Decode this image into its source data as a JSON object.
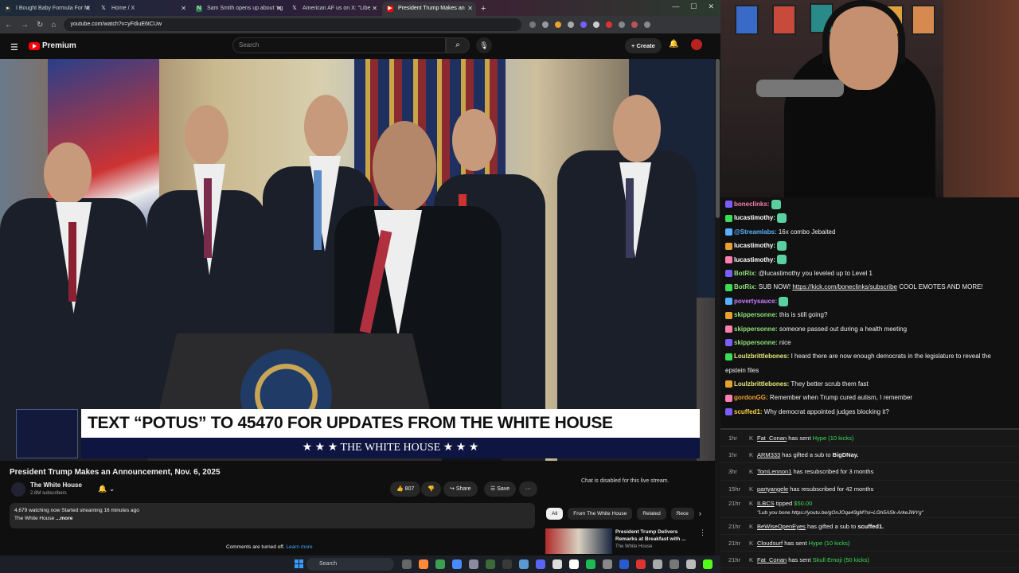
{
  "browser": {
    "tabs": [
      {
        "label": "I Bought Baby Formula For M",
        "active": false
      },
      {
        "label": "Home / X",
        "active": false
      },
      {
        "label": "Sam Smith opens up about 'ng",
        "active": false
      },
      {
        "label": "American AF us on X: \"Libe",
        "active": false
      },
      {
        "label": "President Trump Makes an",
        "active": true
      }
    ],
    "new_tab": "+",
    "url": "youtube.com/watch?v=yFdiuE6tCUw"
  },
  "youtube": {
    "logo": "Premium",
    "search_placeholder": "Search",
    "create_label": "+ Create",
    "video": {
      "lower_third_headline": "TEXT “POTUS” TO 45470 FOR UPDATES FROM THE WHITE HOUSE",
      "lower_third_brand": "★ ★ ★  THE WHITE HOUSE  ★ ★ ★"
    },
    "title": "President Trump Makes an Announcement, Nov. 6, 2025",
    "channel": {
      "name": "The White House",
      "subscribers": "2.8M subscribers"
    },
    "actions": {
      "likes": "807",
      "share": "Share",
      "save": "Save",
      "more": "···"
    },
    "description": {
      "line1": "4,679 watching now  Started streaming 16 minutes ago",
      "line2": "The White House",
      "more": "...more"
    },
    "chat_disabled": "Chat is disabled for this live stream.",
    "chips": [
      "All",
      "From The White House",
      "Related",
      "Rece"
    ],
    "recommendation": {
      "title": "President Trump Delivers Remarks at Breakfast with ...",
      "channel": "The White House"
    },
    "comments_off": "Comments are turned off.",
    "learn_more": "Learn more"
  },
  "chat": [
    {
      "user": "boneclinks:",
      "color": "#ff7fb0",
      "text": ""
    },
    {
      "user": "lucastimothy:",
      "color": "#ffffff",
      "text": ""
    },
    {
      "user": "@Streamlabs:",
      "color": "#57b1ff",
      "text": "16x    combo Jebaited"
    },
    {
      "user": "lucastimothy:",
      "color": "#ffffff",
      "text": ""
    },
    {
      "user": "lucastimothy:",
      "color": "#ffffff",
      "text": ""
    },
    {
      "user": "BotRix:",
      "color": "#8fe07a",
      "text": "@lucastimothy you leveled up to Level 1"
    },
    {
      "user": "BotRix:",
      "color": "#8fe07a",
      "text": "SUB NOW! ",
      "link": "https://kick.com/boneclinks/subscribe",
      "after": " COOL EMOTES AND MORE!"
    },
    {
      "user": "povertysauce:",
      "color": "#c77dff",
      "text": ""
    },
    {
      "user": "skippersonne:",
      "color": "#8fe07a",
      "text": "this is still going?"
    },
    {
      "user": "skippersonne:",
      "color": "#8fe07a",
      "text": "someone passed out during a health meeting"
    },
    {
      "user": "skippersonne:",
      "color": "#8fe07a",
      "text": "nice"
    },
    {
      "user": "Loulzbrittlebones:",
      "color": "#e8e87a",
      "text": "I heard there are now enough democrats in the legislature to reveal the"
    },
    {
      "user": "",
      "color": "#ffffff",
      "text": "epstein files"
    },
    {
      "user": "Loulzbrittlebones:",
      "color": "#e8e87a",
      "text": "They better scrub them fast"
    },
    {
      "user": "gordonGG:",
      "color": "#f0a030",
      "text": "Remember when Trump cured autism, I remember"
    },
    {
      "user": "scuffed1:",
      "color": "#ffd040",
      "text": "Why democrat appointed judges blocking it?"
    }
  ],
  "events": [
    {
      "time": "1hr",
      "name": "Fat_Conan",
      "mid": " has sent ",
      "hl": "Hype (10 kicks)",
      "tail": ""
    },
    {
      "time": "1hr",
      "name": "ARM333",
      "mid": " has gifted a sub to ",
      "hl": "",
      "tail": "BigDNay."
    },
    {
      "time": "3hr",
      "name": "TomLennon1",
      "mid": " has resubscribed for 3 months",
      "hl": "",
      "tail": ""
    },
    {
      "time": "15hr",
      "name": "partyangele",
      "mid": " has resubscribed for 42 months",
      "hl": "",
      "tail": ""
    },
    {
      "time": "21hr",
      "name": "ILBCS",
      "mid": " tipped ",
      "hl": "$50.00",
      "tail": "",
      "tip": "\"Lub you bone https://youtu.be/gOnJOqa43gM?si=LGh5ASk-ArkeJWYg\""
    },
    {
      "time": "21hr",
      "name": "BeWiseOpenEyes",
      "mid": " has gifted a sub to ",
      "hl": "",
      "tail": "scuffed1."
    },
    {
      "time": "21hr",
      "name": "Cloudsurf",
      "mid": " has sent ",
      "hl": "Hype (10 kicks)",
      "tail": ""
    },
    {
      "time": "21hr",
      "name": "Fat_Conan",
      "mid": " has sent ",
      "hl": "Skull Emoji (50 kicks)",
      "tail": ""
    }
  ],
  "taskbar": {
    "search": "Search"
  }
}
